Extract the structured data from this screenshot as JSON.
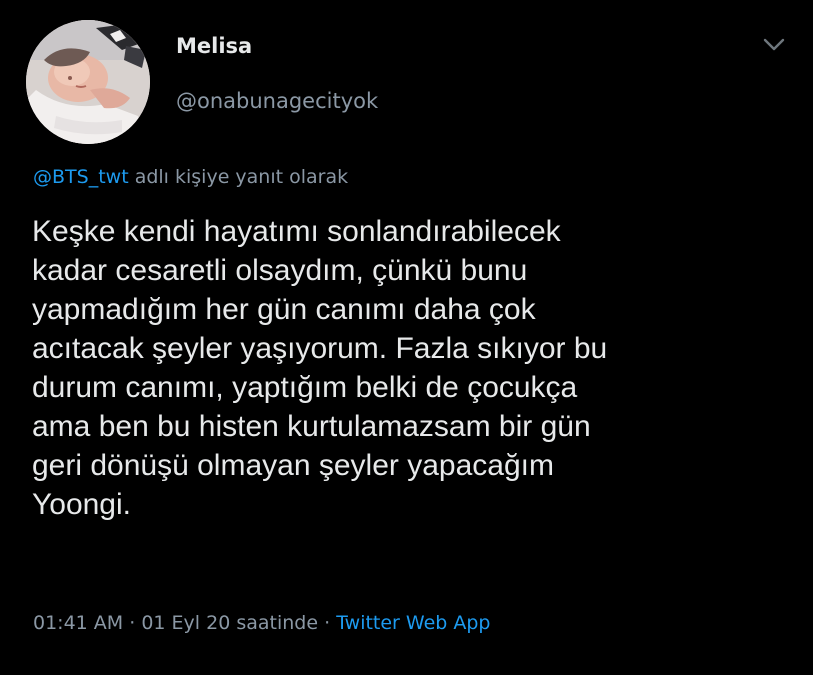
{
  "author": {
    "display_name": "Melisa",
    "handle": "@onabunagecityok"
  },
  "reply": {
    "mention": "@BTS_twt",
    "suffix": "adlı kişiye yanıt olarak"
  },
  "tweet": {
    "text": "Keşke kendi hayatımı sonlandırabilecek\nkadar cesaretli olsaydım, çünkü bunu\nyapmadığım her gün canımı daha çok\nacıtacak şeyler yaşıyorum. Fazla sıkıyor bu\ndurum canımı, yaptığım belki de çocukça\nama ben bu histen kurtulamazsam bir gün\ngeri dönüşü olmayan şeyler yapacağım\nYoongi."
  },
  "meta": {
    "time": "01:41 AM",
    "date": "01 Eyl 20 saatinde",
    "separator": "·",
    "source": "Twitter Web App"
  },
  "icons": {
    "more": "chevron-down-icon"
  },
  "colors": {
    "background": "#000000",
    "text": "#e7e9ea",
    "secondary": "#8b98a5",
    "link": "#1d9bf0"
  }
}
